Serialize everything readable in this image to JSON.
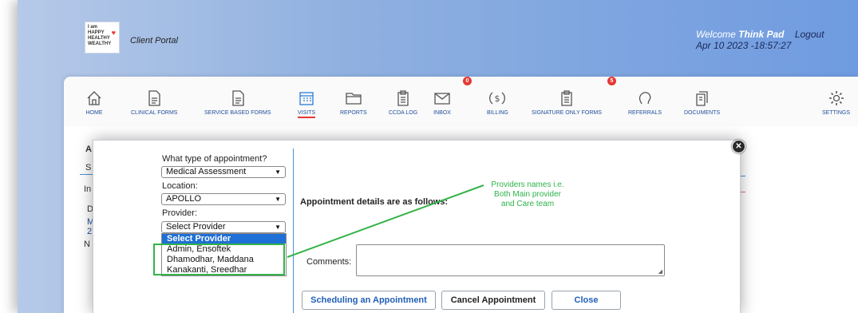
{
  "header": {
    "logo_text": "I am HAPPY HEALTHY WEALTHY",
    "portal_title": "Client Portal",
    "welcome_prefix": "Welcome",
    "user_name": "Think Pad",
    "logout_label": "Logout",
    "datetime": "Apr 10 2023 -18:57:27"
  },
  "nav": {
    "items": [
      {
        "label": "HOME",
        "icon": "home-icon"
      },
      {
        "label": "CLINICAL FORMS",
        "icon": "document-icon"
      },
      {
        "label": "SERVICE BASED FORMS",
        "icon": "document-icon"
      },
      {
        "label": "VISITS",
        "icon": "calendar-icon",
        "active": true
      },
      {
        "label": "REPORTS",
        "icon": "folder-icon"
      },
      {
        "label": "CCDA LOG",
        "icon": "clipboard-icon"
      },
      {
        "label": "INBOX",
        "icon": "mail-icon",
        "badge": "0"
      },
      {
        "label": "BILLING",
        "icon": "dollar-icon"
      },
      {
        "label": "SIGNATURE ONLY FORMS",
        "icon": "clipboard-icon",
        "badge": "5"
      },
      {
        "label": "REFERRALS",
        "icon": "referral-icon"
      },
      {
        "label": "DOCUMENTS",
        "icon": "documents-icon"
      },
      {
        "label": "SETTINGS",
        "icon": "gear-icon"
      }
    ]
  },
  "background_fragments": {
    "a": "A",
    "s": "S",
    "in": "In",
    "d": "D",
    "m": "M",
    "two": "2",
    "n": "N"
  },
  "modal": {
    "type_label": "What type of appointment?",
    "type_value": "Medical Assessment",
    "location_label": "Location:",
    "location_value": "APOLLO",
    "provider_label": "Provider:",
    "provider_value": "Select Provider",
    "provider_options": [
      "Select Provider",
      "Admin, Ensoftek",
      "Dhamodhar, Maddana",
      "Kanakanti, Sreedhar"
    ],
    "details_text": "Appointment details are as follows:",
    "comments_label": "Comments:",
    "comments_value": "",
    "buttons": {
      "schedule": "Scheduling an Appointment",
      "cancel": "Cancel Appointment",
      "close": "Close"
    },
    "close_icon": "close-icon"
  },
  "annotation": {
    "line1": "Providers names i.e.",
    "line2": "Both Main provider",
    "line3": "and Care team",
    "color": "#2db34a"
  },
  "colors": {
    "accent_blue": "#1f4e9c",
    "highlight": "#1e6fd6",
    "badge_red": "#e53935"
  }
}
